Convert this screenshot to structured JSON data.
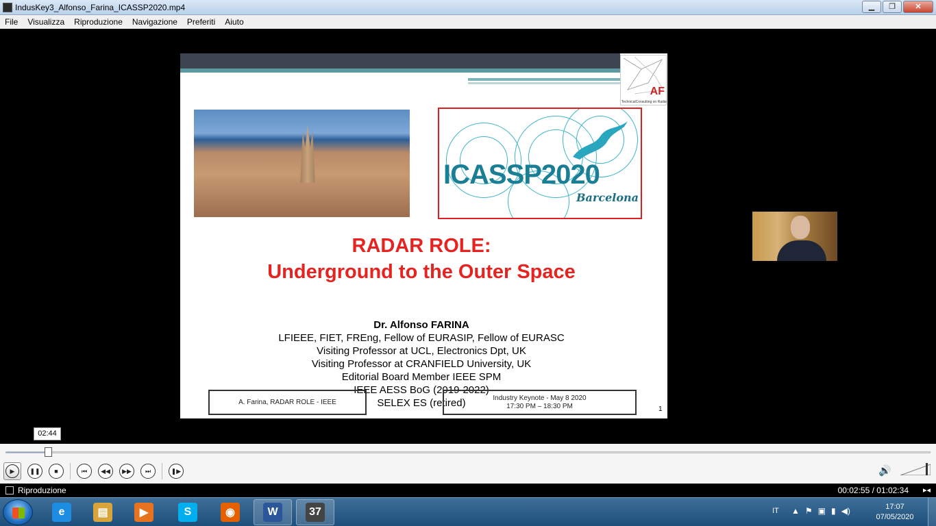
{
  "window": {
    "title": "IndusKey3_Alfonso_Farina_ICASSP2020.mp4",
    "minimize": "▁",
    "maximize": "❐",
    "close": "✕"
  },
  "menu": [
    "File",
    "Visualizza",
    "Riproduzione",
    "Navigazione",
    "Preferiti",
    "Aiuto"
  ],
  "slide": {
    "logo_mark": "AF",
    "logo_caption": "TechnicalConsulting on Radar",
    "icassp_brand": "ICASSP2020",
    "icassp_city": "Barcelona",
    "title_line1": "RADAR ROLE:",
    "title_line2": "Underground to the Outer Space",
    "speaker_name": "Dr. Alfonso FARINA",
    "speaker_lines": [
      "LFIEEE, FIET, FREng, Fellow of EURASIP, Fellow of EURASC",
      "Visiting Professor at UCL, Electronics Dpt, UK",
      "Visiting Professor at CRANFIELD University, UK",
      "Editorial Board Member IEEE SPM",
      "IEEE AESS BoG (2019-2022)",
      "SELEX ES (retired)"
    ],
    "footer_left": "A. Farina, RADAR ROLE - IEEE",
    "footer_right_line1": "Industry Keynote - May 8 2020",
    "footer_right_line2": "17:30 PM – 18:30 PM",
    "page_number": "1"
  },
  "player": {
    "seek_tooltip": "02:44",
    "progress_fraction": 0.044,
    "status_text": "Riproduzione",
    "time_display": "00:02:55 / 01:02:34",
    "volume_fraction": 0.9
  },
  "taskbar": {
    "apps": [
      {
        "name": "internet-explorer",
        "glyph": "e",
        "color": "#1c8de0"
      },
      {
        "name": "file-explorer",
        "glyph": "▤",
        "color": "#d9a53a"
      },
      {
        "name": "media-player",
        "glyph": "▶",
        "color": "#e8731e"
      },
      {
        "name": "skype",
        "glyph": "S",
        "color": "#00aff0"
      },
      {
        "name": "firefox",
        "glyph": "◉",
        "color": "#e66000"
      },
      {
        "name": "word",
        "glyph": "W",
        "color": "#2b579a"
      },
      {
        "name": "media-player-classic",
        "glyph": "37",
        "color": "#444"
      }
    ],
    "lang": "IT",
    "time": "17:07",
    "date": "07/05/2020"
  }
}
